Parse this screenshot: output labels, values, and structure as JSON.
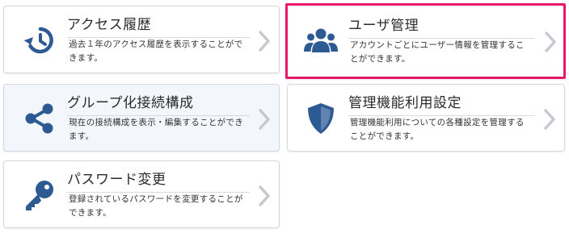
{
  "cards": [
    {
      "id": "access-history",
      "title": "アクセス履歴",
      "description": "過去１年のアクセス履歴を表示することができます。",
      "icon": "history-icon"
    },
    {
      "id": "user-management",
      "title": "ユーザ管理",
      "description": "アカウントごとにユーザー情報を管理することができます。",
      "icon": "users-icon"
    },
    {
      "id": "group-config",
      "title": "グループ化接続構成",
      "description": "現在の接続構成を表示・編集することができます。",
      "icon": "share-icon"
    },
    {
      "id": "management-settings",
      "title": "管理機能利用設定",
      "description": "管理機能利用についての各種設定を管理することができます。",
      "icon": "shield-icon"
    },
    {
      "id": "password-change",
      "title": "パスワード変更",
      "description": "登録されているパスワードを変更することができます。",
      "icon": "key-icon"
    }
  ],
  "colors": {
    "icon": "#2e5a94",
    "highlight": "#e8196a",
    "chevron": "#c6cad0"
  }
}
